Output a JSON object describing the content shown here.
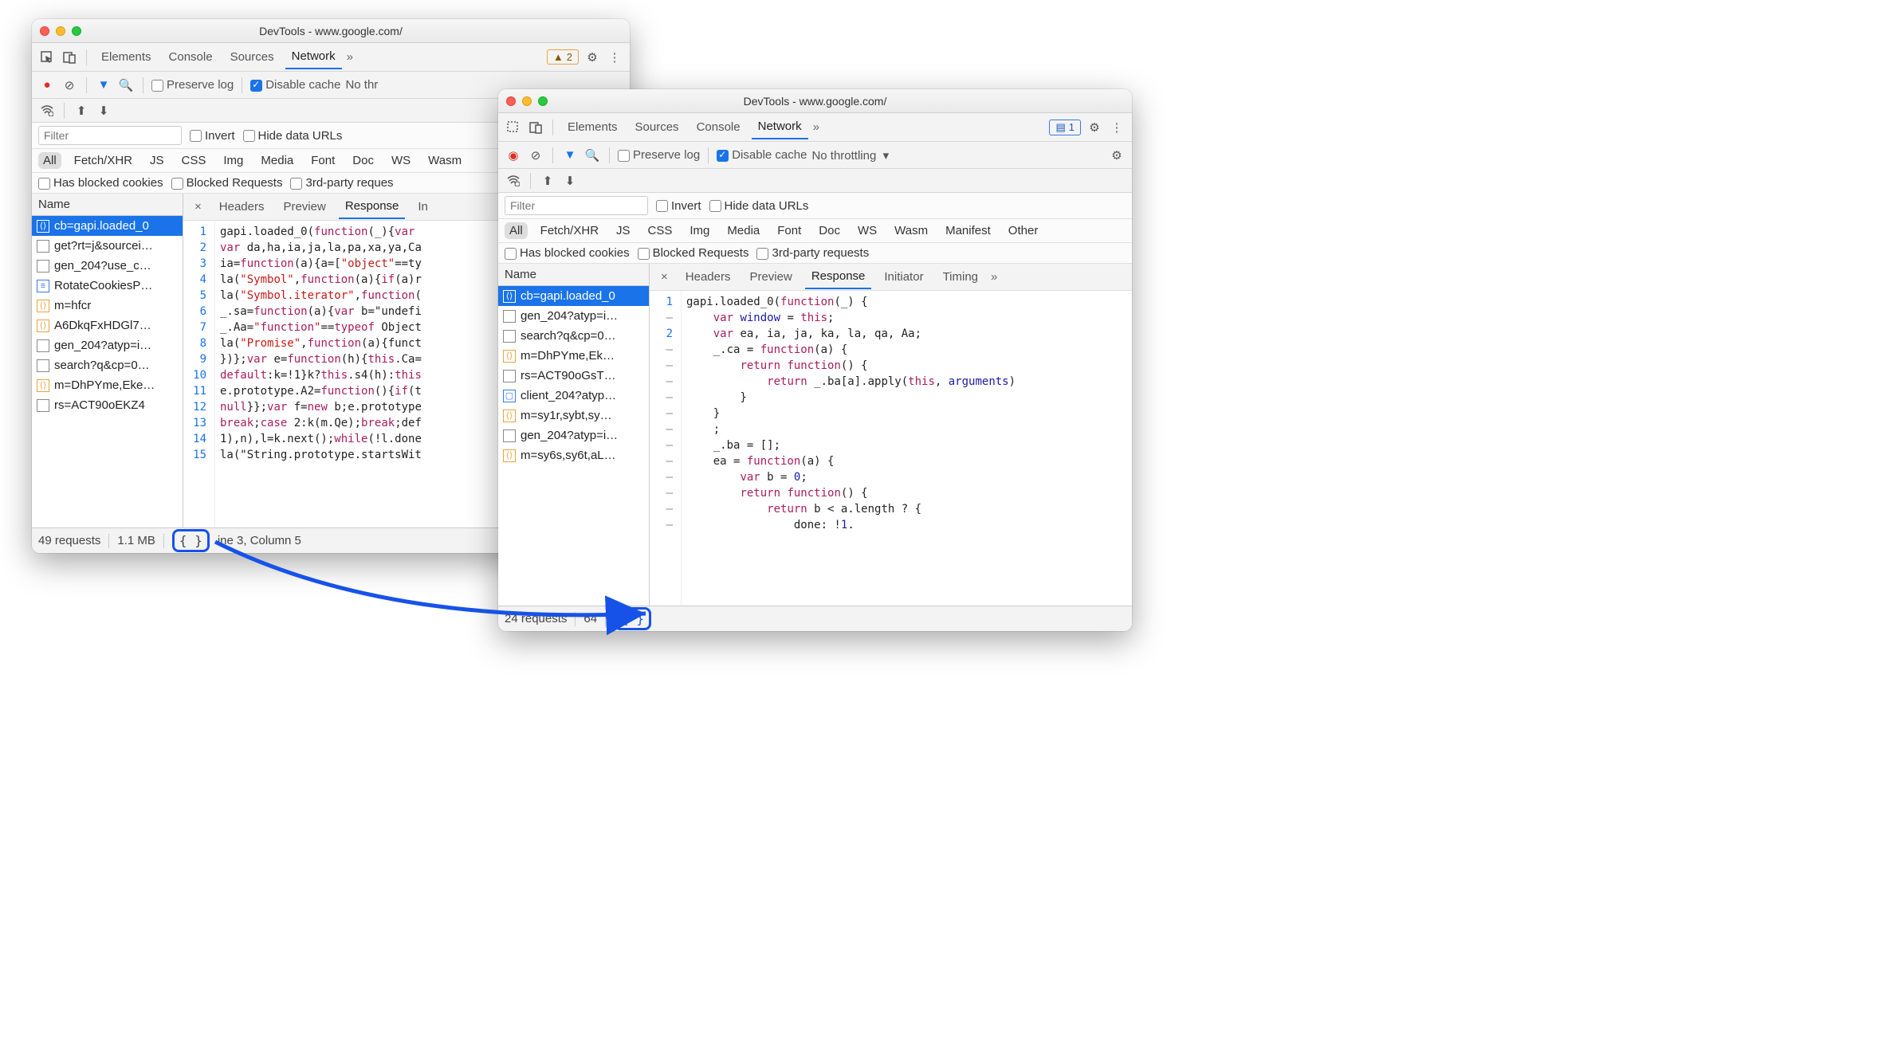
{
  "window_a": {
    "title": "DevTools - www.google.com/",
    "tabs": [
      "Elements",
      "Console",
      "Sources",
      "Network"
    ],
    "active_tab": "Network",
    "warn_count": "2",
    "preserve_log": "Preserve log",
    "disable_cache": "Disable cache",
    "throttling": "No thr",
    "filter_placeholder": "Filter",
    "invert": "Invert",
    "hide_data_urls": "Hide data URLs",
    "type_chips": [
      "All",
      "Fetch/XHR",
      "JS",
      "CSS",
      "Img",
      "Media",
      "Font",
      "Doc",
      "WS",
      "Wasm"
    ],
    "has_blocked_cookies": "Has blocked cookies",
    "blocked_requests": "Blocked Requests",
    "third_party": "3rd-party reques",
    "name_header": "Name",
    "files": [
      {
        "icon": "js",
        "label": "cb=gapi.loaded_0",
        "sel": true
      },
      {
        "icon": "plain",
        "label": "get?rt=j&sourcei…"
      },
      {
        "icon": "plain",
        "label": "gen_204?use_c…"
      },
      {
        "icon": "doc",
        "label": "RotateCookiesP…"
      },
      {
        "icon": "js",
        "label": "m=hfcr"
      },
      {
        "icon": "js",
        "label": "A6DkqFxHDGl7…"
      },
      {
        "icon": "plain",
        "label": "gen_204?atyp=i…"
      },
      {
        "icon": "plain",
        "label": "search?q&cp=0…"
      },
      {
        "icon": "js",
        "label": "m=DhPYme,Eke…"
      },
      {
        "icon": "plain",
        "label": "rs=ACT90oEKZ4"
      }
    ],
    "detail_tabs": [
      "Headers",
      "Preview",
      "Response",
      "In"
    ],
    "active_detail": "Response",
    "code_lines": [
      {
        "n": "1",
        "t": "gapi.loaded_0(function(_){var "
      },
      {
        "n": "2",
        "t": "var da,ha,ia,ja,la,pa,xa,ya,Ca"
      },
      {
        "n": "3",
        "t": "ia=function(a){a=[\"object\"==ty"
      },
      {
        "n": "4",
        "t": "la(\"Symbol\",function(a){if(a)r"
      },
      {
        "n": "5",
        "t": "la(\"Symbol.iterator\",function("
      },
      {
        "n": "6",
        "t": "_.sa=function(a){var b=\"undefi"
      },
      {
        "n": "7",
        "t": "_.Aa=\"function\"==typeof Object"
      },
      {
        "n": "8",
        "t": "la(\"Promise\",function(a){funct"
      },
      {
        "n": "9",
        "t": "})};var e=function(h){this.Ca="
      },
      {
        "n": "10",
        "t": "default:k=!1}k?this.s4(h):this"
      },
      {
        "n": "11",
        "t": "e.prototype.A2=function(){if(t"
      },
      {
        "n": "12",
        "t": "null}};var f=new b;e.prototype"
      },
      {
        "n": "13",
        "t": "break;case 2:k(m.Qe);break;def"
      },
      {
        "n": "14",
        "t": "1),n),l=k.next();while(!l.done"
      },
      {
        "n": "15",
        "t": "la(\"String.prototype.startsWit"
      }
    ],
    "status_requests": "49 requests",
    "status_size": "1.1 MB",
    "status_cursor": "ine 3, Column 5"
  },
  "window_b": {
    "title": "DevTools - www.google.com/",
    "tabs": [
      "Elements",
      "Sources",
      "Console",
      "Network"
    ],
    "active_tab": "Network",
    "msg_count": "1",
    "preserve_log": "Preserve log",
    "disable_cache": "Disable cache",
    "throttling": "No throttling",
    "filter_placeholder": "Filter",
    "invert": "Invert",
    "hide_data_urls": "Hide data URLs",
    "type_chips": [
      "All",
      "Fetch/XHR",
      "JS",
      "CSS",
      "Img",
      "Media",
      "Font",
      "Doc",
      "WS",
      "Wasm",
      "Manifest",
      "Other"
    ],
    "has_blocked_cookies": "Has blocked cookies",
    "blocked_requests": "Blocked Requests",
    "third_party": "3rd-party requests",
    "name_header": "Name",
    "files": [
      {
        "icon": "js",
        "label": "cb=gapi.loaded_0",
        "sel": true
      },
      {
        "icon": "plain",
        "label": "gen_204?atyp=i…"
      },
      {
        "icon": "plain",
        "label": "search?q&cp=0…"
      },
      {
        "icon": "js",
        "label": "m=DhPYme,Ek…"
      },
      {
        "icon": "plain",
        "label": "rs=ACT90oGsT…"
      },
      {
        "icon": "img",
        "label": "client_204?atyp…"
      },
      {
        "icon": "js",
        "label": "m=sy1r,sybt,sy…"
      },
      {
        "icon": "plain",
        "label": "gen_204?atyp=i…"
      },
      {
        "icon": "js",
        "label": "m=sy6s,sy6t,aL…"
      }
    ],
    "detail_tabs": [
      "Headers",
      "Preview",
      "Response",
      "Initiator",
      "Timing"
    ],
    "active_detail": "Response",
    "code_lines": [
      "gapi.loaded_0(function(_) {",
      "    var window = this;",
      "    var ea, ia, ja, ka, la, qa, Aa;",
      "    _.ca = function(a) {",
      "        return function() {",
      "            return _.ba[a].apply(this, arguments)",
      "        }",
      "    }",
      "    ;",
      "    _.ba = [];",
      "    ea = function(a) {",
      "        var b = 0;",
      "        return function() {",
      "            return b < a.length ? {",
      "                done: !1."
    ],
    "gutter": [
      "1",
      "–",
      "2",
      "–",
      "–",
      "–",
      "–",
      "–",
      "–",
      "–",
      "–",
      "–",
      "–",
      "–",
      "–"
    ],
    "status_requests": "24 requests",
    "status_size": "64"
  }
}
